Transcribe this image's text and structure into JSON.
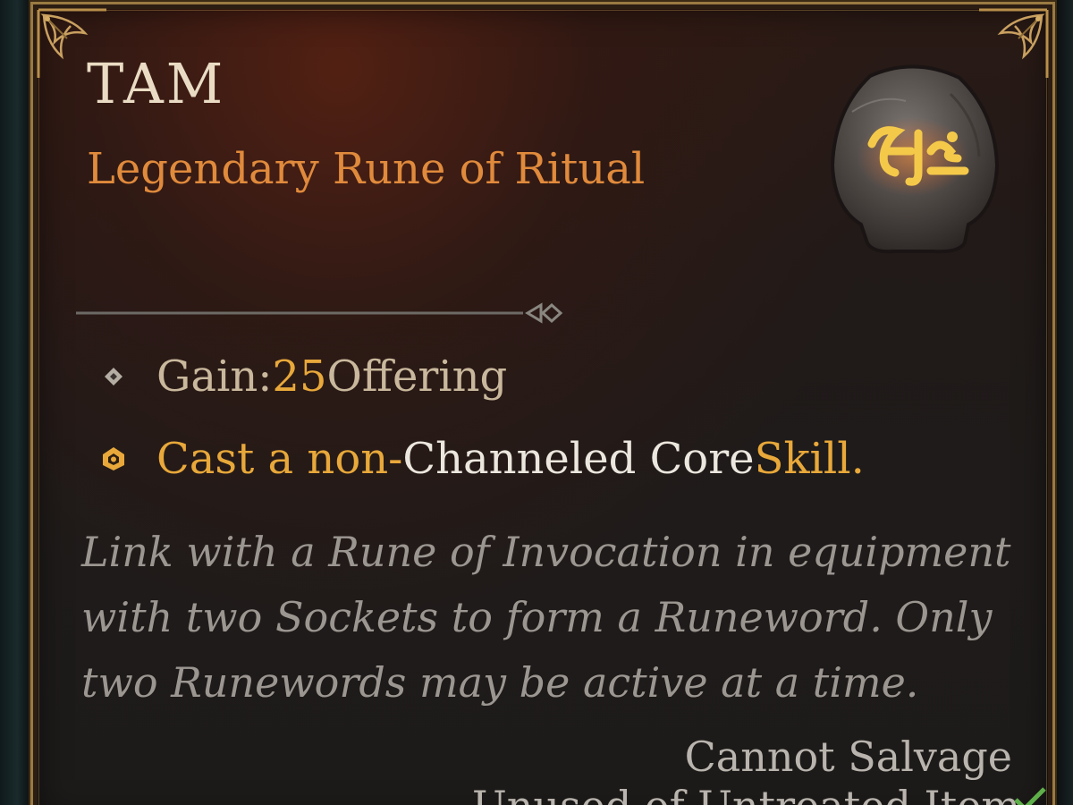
{
  "item": {
    "name": "TAM",
    "rarity_type": "Legendary Rune of Ritual",
    "icon": "rune-stone-icon",
    "affixes": [
      {
        "icon": "diamond-bullet-icon",
        "label": "Gain: ",
        "value": "25",
        "suffix": " Offering"
      },
      {
        "icon": "condition-bullet-icon",
        "prefix": "Cast a non-",
        "highlight": "Channeled Core",
        "suffix": " Skill."
      }
    ],
    "description": "Link with a Rune of Invocation in equipment with two Sockets to form a Runeword. Only two Runewords may be active at a time.",
    "salvage": "Cannot Salvage",
    "cutoff_line": "Unused of Untreated Item"
  },
  "colors": {
    "title": "#eadcc4",
    "legendary": "#e08a3c",
    "gold_highlight": "#e8a83a",
    "frame_gold": "#9a7a43",
    "flavor": "#9c9691"
  }
}
